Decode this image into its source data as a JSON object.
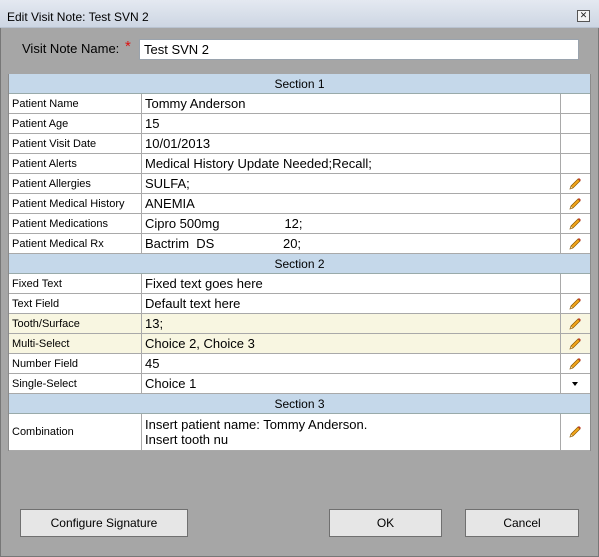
{
  "window": {
    "title": "Edit Visit Note: Test SVN 2",
    "close_glyph": "✕"
  },
  "note_name": {
    "label": "Visit Note Name:",
    "required_mark": "*",
    "value": "Test SVN 2"
  },
  "sections": [
    {
      "title": "Section 1",
      "rows": [
        {
          "label": "Patient Name",
          "value": "Tommy Anderson",
          "action": "none"
        },
        {
          "label": "Patient Age",
          "value": "15",
          "action": "none"
        },
        {
          "label": "Patient Visit Date",
          "value": "10/01/2013",
          "action": "none"
        },
        {
          "label": "Patient Alerts",
          "value": "Medical History Update Needed;Recall;",
          "action": "none"
        },
        {
          "label": "Patient Allergies",
          "value": "SULFA;",
          "action": "edit"
        },
        {
          "label": "Patient Medical History",
          "value": "ANEMIA",
          "action": "edit"
        },
        {
          "label": "Patient Medications",
          "value": "Cipro 500mg                  12;",
          "action": "edit"
        },
        {
          "label": "Patient Medical Rx",
          "value": "Bactrim  DS                   20;",
          "action": "edit"
        }
      ]
    },
    {
      "title": "Section 2",
      "rows": [
        {
          "label": "Fixed Text",
          "value": "Fixed text goes here",
          "action": "none"
        },
        {
          "label": "Text Field",
          "value": "Default text here",
          "action": "edit"
        },
        {
          "label": "Tooth/Surface",
          "value": "13;",
          "action": "edit",
          "highlight": true
        },
        {
          "label": "Multi-Select",
          "value": "Choice 2, Choice 3",
          "action": "edit",
          "highlight": true
        },
        {
          "label": "Number Field",
          "value": "45",
          "action": "edit"
        },
        {
          "label": "Single-Select",
          "value": "Choice 1",
          "action": "dropdown"
        }
      ]
    },
    {
      "title": "Section 3",
      "rows": [
        {
          "label": "Combination",
          "value": "Insert patient name: Tommy Anderson.\nInsert tooth nu",
          "action": "edit",
          "tall": true
        }
      ]
    }
  ],
  "buttons": {
    "configure_signature": "Configure Signature",
    "ok": "OK",
    "cancel": "Cancel"
  },
  "colors": {
    "section_header": "#c5d8ea",
    "highlight_row": "#f8f6e1",
    "pencil_body": "#f2a51a",
    "pencil_tip": "#c0392b"
  }
}
